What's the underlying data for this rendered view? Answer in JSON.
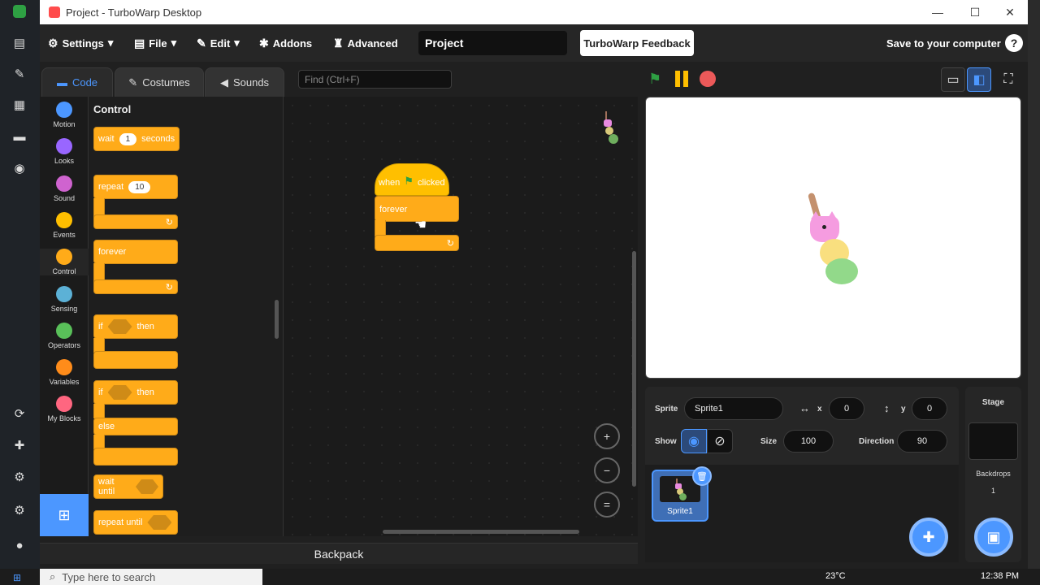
{
  "window": {
    "title": "Project - TurboWarp Desktop",
    "minimize": "—",
    "maximize": "☐",
    "close": "✕"
  },
  "menubar": {
    "settings": "Settings",
    "file": "File",
    "edit": "Edit",
    "addons": "Addons",
    "advanced": "Advanced",
    "project_name": "Project",
    "feedback": "TurboWarp Feedback",
    "save": "Save to your computer",
    "help": "?"
  },
  "tabs": {
    "code": "Code",
    "costumes": "Costumes",
    "sounds": "Sounds"
  },
  "find_placeholder": "Find (Ctrl+F)",
  "categories": [
    {
      "label": "Motion",
      "color": "#4c97ff"
    },
    {
      "label": "Looks",
      "color": "#9966ff"
    },
    {
      "label": "Sound",
      "color": "#cf63cf"
    },
    {
      "label": "Events",
      "color": "#ffbf00"
    },
    {
      "label": "Control",
      "color": "#ffab19"
    },
    {
      "label": "Sensing",
      "color": "#5cb1d6"
    },
    {
      "label": "Operators",
      "color": "#59c059"
    },
    {
      "label": "Variables",
      "color": "#ff8c1a"
    },
    {
      "label": "My Blocks",
      "color": "#ff6680"
    }
  ],
  "palette": {
    "title": "Control",
    "wait": {
      "pre": "wait",
      "value": "1",
      "post": "seconds"
    },
    "repeat": {
      "pre": "repeat",
      "value": "10"
    },
    "forever": "forever",
    "if_then": {
      "if": "if",
      "then": "then"
    },
    "if_else": {
      "if": "if",
      "then": "then",
      "else": "else"
    },
    "wait_until": "wait until",
    "repeat_until": "repeat until"
  },
  "script": {
    "when": "when",
    "clicked": "clicked",
    "forever": "forever"
  },
  "zoom": {
    "in": "+",
    "out": "−",
    "reset": "="
  },
  "backpack": "Backpack",
  "sprite_info": {
    "sprite_label": "Sprite",
    "sprite_name": "Sprite1",
    "x_label": "x",
    "x": "0",
    "y_label": "y",
    "y": "0",
    "show_label": "Show",
    "size_label": "Size",
    "size": "100",
    "direction_label": "Direction",
    "direction": "90"
  },
  "sprite_list": [
    {
      "name": "Sprite1"
    }
  ],
  "stage_pane": {
    "title": "Stage",
    "backdrops_label": "Backdrops",
    "backdrops_count": "1"
  },
  "taskbar": {
    "search_placeholder": "Type here to search",
    "temp": "23°C",
    "time": "12:38 PM"
  }
}
